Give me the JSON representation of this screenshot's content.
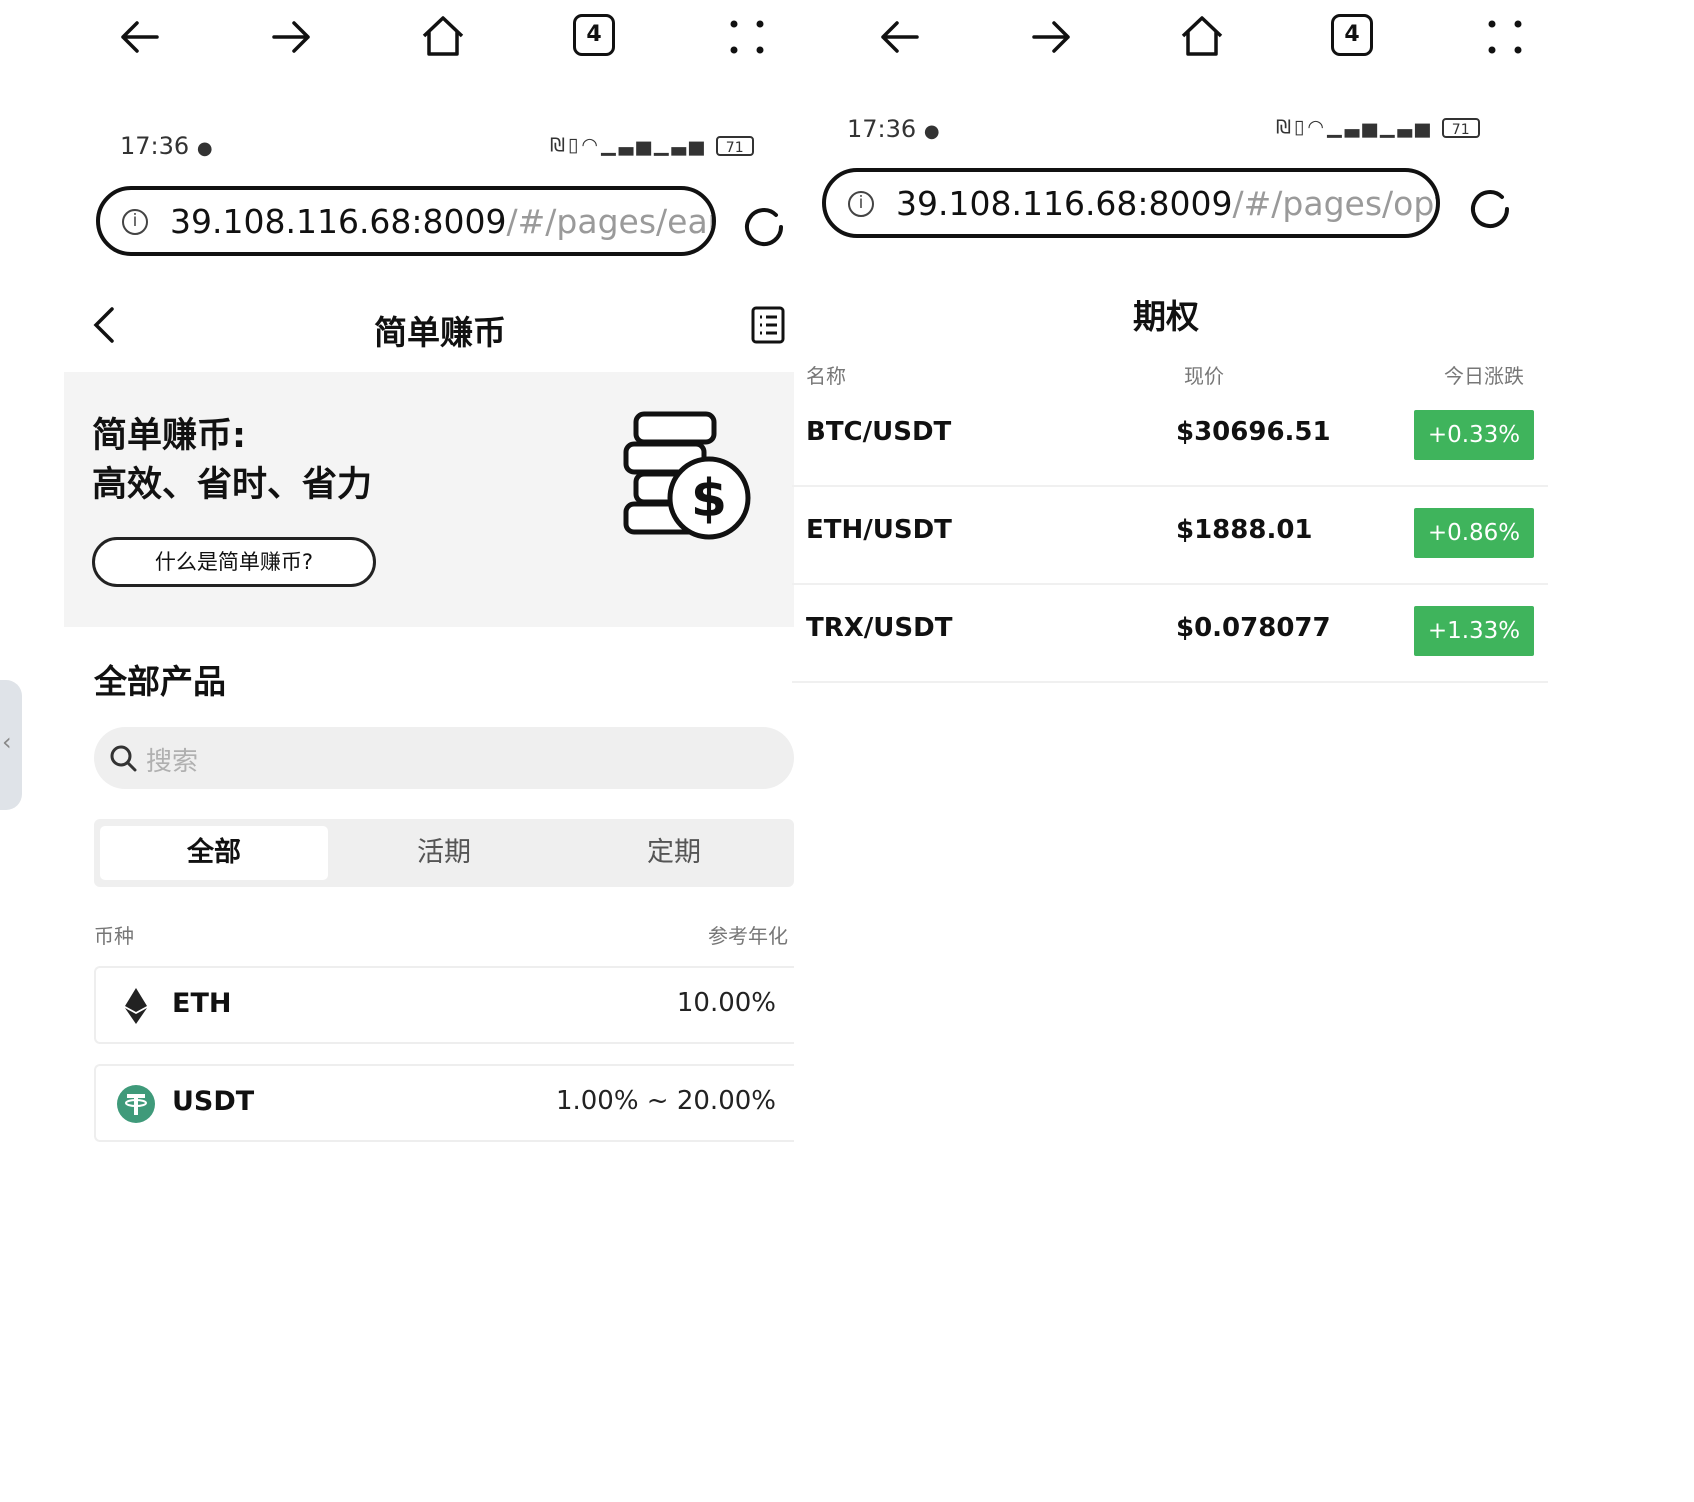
{
  "left": {
    "nav": {
      "tab_count": "4"
    },
    "status": {
      "time": "17:36",
      "battery": "71"
    },
    "url": {
      "host": "39.108.116.68:8009",
      "path": "/#/pages/earn"
    },
    "header": {
      "title": "简单赚币"
    },
    "hero": {
      "line1": "简单赚币:",
      "line2": "高效、省时、省力",
      "button": "什么是简单赚币?"
    },
    "section_title": "全部产品",
    "search": {
      "placeholder": "搜索"
    },
    "tabs": [
      "全部",
      "活期",
      "定期"
    ],
    "columns": {
      "coin": "币种",
      "apy": "参考年化"
    },
    "assets": [
      {
        "name": "ETH",
        "rate": "10.00%",
        "icon": "ethereum-icon"
      },
      {
        "name": "USDT",
        "rate": "1.00% ~ 20.00%",
        "icon": "tether-icon"
      }
    ]
  },
  "right": {
    "nav": {
      "tab_count": "4"
    },
    "status": {
      "time": "17:36",
      "battery": "71"
    },
    "url": {
      "host": "39.108.116.68:8009",
      "path": "/#/pages/optic"
    },
    "header": {
      "title": "期权"
    },
    "columns": {
      "name": "名称",
      "price": "现价",
      "change": "今日涨跌"
    },
    "rows": [
      {
        "pair": "BTC/USDT",
        "price": "$30696.51",
        "change": "+0.33%"
      },
      {
        "pair": "ETH/USDT",
        "price": "$1888.01",
        "change": "+0.86%"
      },
      {
        "pair": "TRX/USDT",
        "price": "$0.078077",
        "change": "+1.33%"
      }
    ]
  },
  "colors": {
    "positive": "#3fb45c",
    "tether": "#3f9a7a"
  }
}
